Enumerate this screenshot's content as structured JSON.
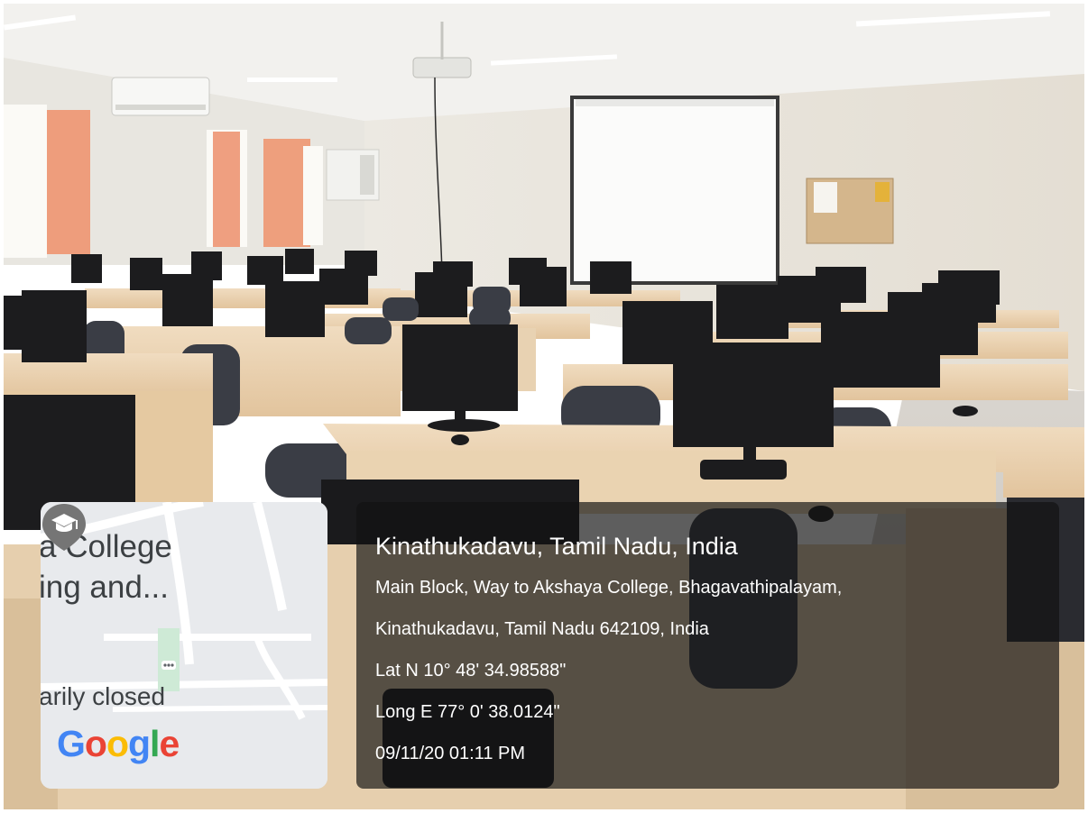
{
  "map": {
    "label_line1": "a College",
    "label_line2": "ing and...",
    "label_line3": "arily closed",
    "logo_text": [
      "G",
      "o",
      "o",
      "g",
      "l",
      "e"
    ],
    "logo_colors": [
      "#4285F4",
      "#EA4335",
      "#FBBC05",
      "#4285F4",
      "#34A853",
      "#EA4335"
    ],
    "pin_icon": "graduation-cap-pin",
    "pin_color": "#757575"
  },
  "info": {
    "title": "Kinathukadavu, Tamil Nadu, India",
    "address_line1": "Main Block, Way to Akshaya College, Bhagavathipalayam,",
    "address_line2": "Kinathukadavu, Tamil Nadu 642109, India",
    "latitude": "Lat N 10° 48' 34.98588\"",
    "longitude": "Long E 77° 0' 38.0124\"",
    "timestamp": "09/11/20 01:11 PM"
  }
}
